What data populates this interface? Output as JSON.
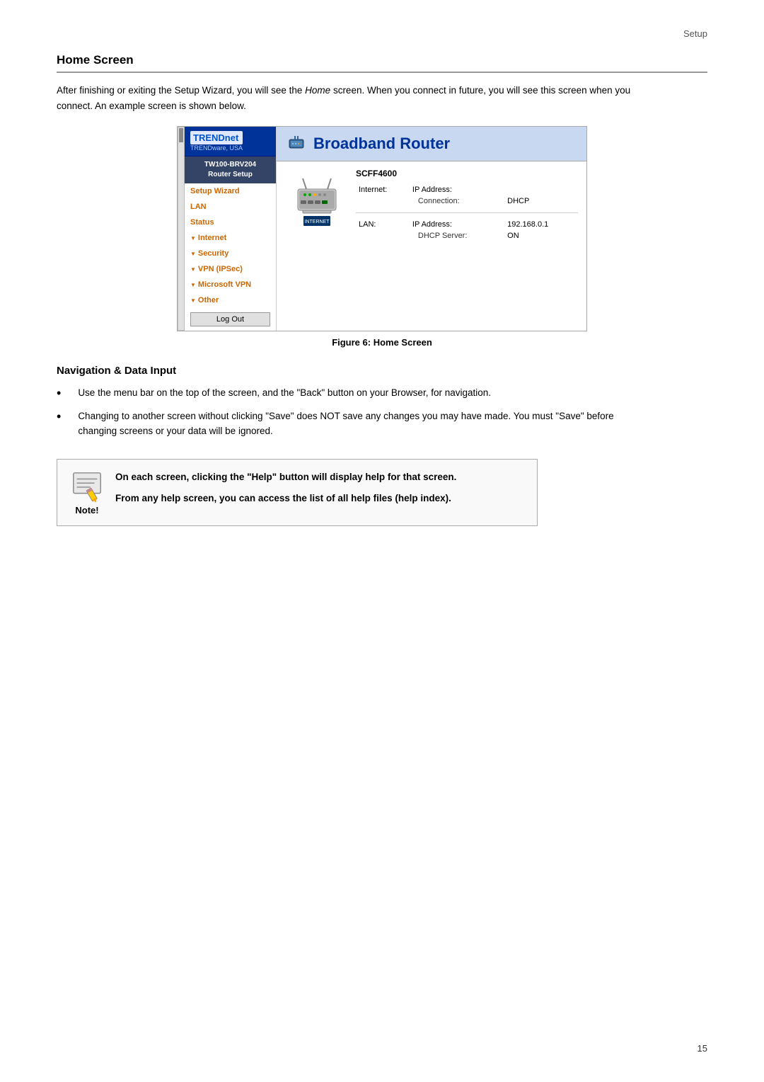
{
  "header": {
    "page_label": "Setup"
  },
  "home_screen": {
    "title": "Home Screen",
    "intro": "After finishing or exiting the Setup Wizard, you will see the ",
    "intro_italic": "Home",
    "intro_rest": " screen. When you connect in future, you will see this screen when you connect. An example screen is shown below.",
    "figure_caption": "Figure 6: Home Screen"
  },
  "router_ui": {
    "brand": "TRENDnet",
    "brand_sub": "TRENDware, USA",
    "model_line1": "TW100-BRV204",
    "model_line2": "Router Setup",
    "broadband_title": "Broadband Router",
    "nav_items": [
      {
        "label": "Setup Wizard",
        "type": "link"
      },
      {
        "label": "LAN",
        "type": "link"
      },
      {
        "label": "Status",
        "type": "link"
      },
      {
        "label": "Internet",
        "type": "dropdown"
      },
      {
        "label": "Security",
        "type": "dropdown"
      },
      {
        "label": "VPN (IPSec)",
        "type": "dropdown"
      },
      {
        "label": "Microsoft VPN",
        "type": "dropdown"
      },
      {
        "label": "Other",
        "type": "dropdown"
      }
    ],
    "logout_label": "Log Out",
    "device_model": "SCFF4600",
    "internet_label": "Internet:",
    "internet_ip_label": "IP Address:",
    "internet_connection_label": "Connection:",
    "internet_connection_value": "DHCP",
    "lan_label": "LAN:",
    "lan_ip_label": "IP Address:",
    "lan_ip_value": "192.168.0.1",
    "lan_dhcp_label": "DHCP Server:",
    "lan_dhcp_value": "ON"
  },
  "nav_section": {
    "title": "Navigation & Data Input",
    "bullets": [
      "Use the menu bar on the top of the screen, and the \"Back\" button on your Browser, for navigation.",
      "Changing to another screen without clicking \"Save\" does NOT save any changes you may have made. You must \"Save\" before changing screens or your data will be ignored."
    ]
  },
  "note_box": {
    "label": "Note!",
    "line1": "On each screen, clicking the \"Help\" button will display help for that screen.",
    "line2": "From any help screen, you can access the list of all help files (help index)."
  },
  "page_number": "15"
}
